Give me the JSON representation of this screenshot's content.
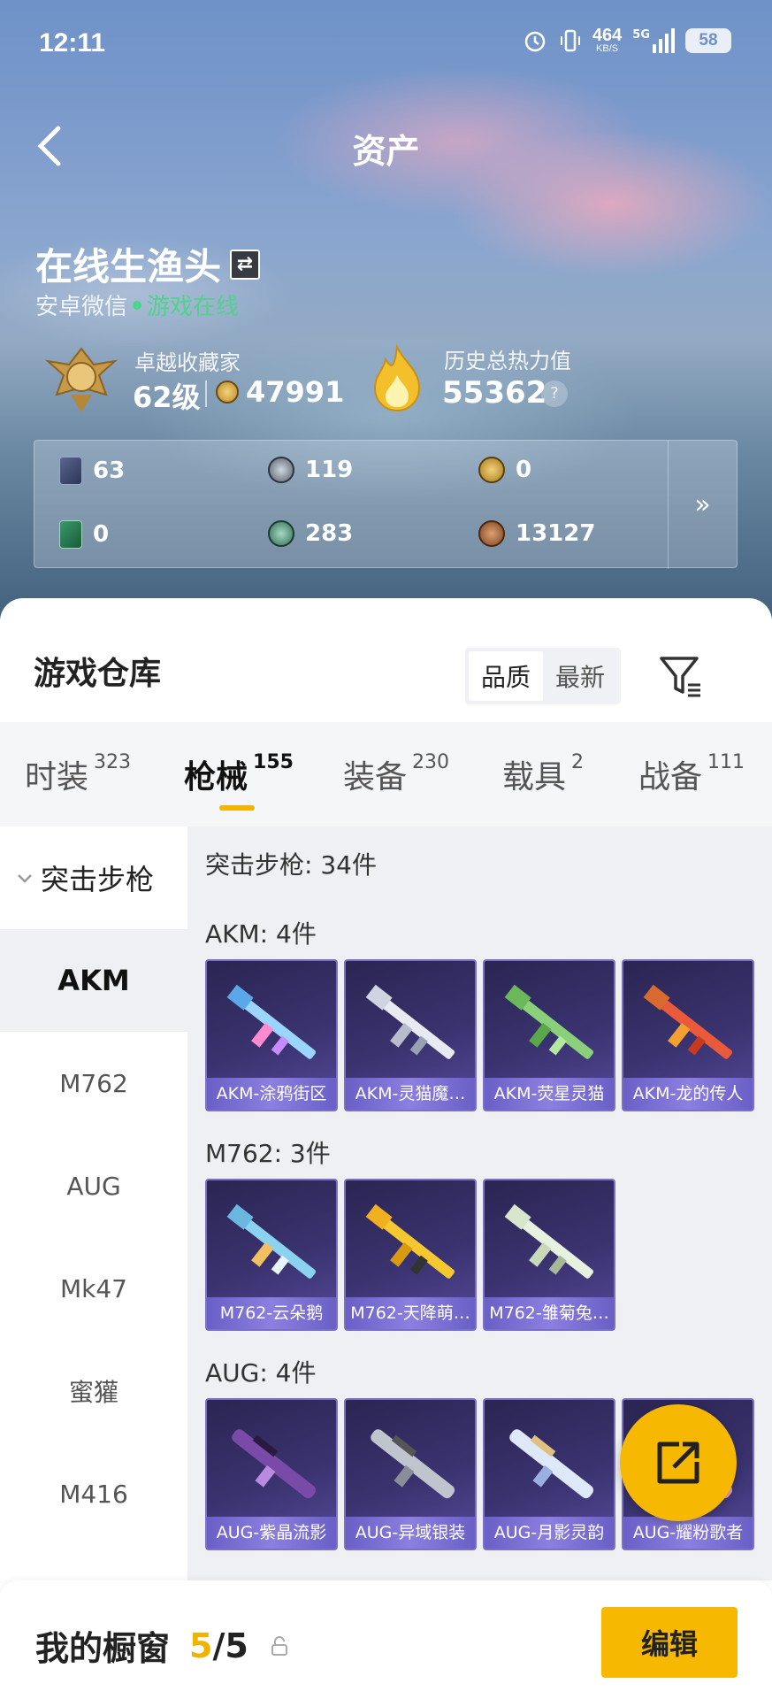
{
  "status_bar": {
    "time": "12:11",
    "net_speed": "464",
    "net_unit": "KB/S",
    "signal": "5G",
    "battery": "58"
  },
  "header": {
    "title": "资产"
  },
  "profile": {
    "username": "在线生渔头",
    "platform": "安卓微信",
    "status": "游戏在线",
    "collector_label": "卓越收藏家",
    "collector_level": "62级",
    "collector_points": "47991",
    "heat_label": "历史总热力值",
    "heat_value": "55362",
    "help_icon": "question-icon"
  },
  "stats": [
    {
      "icon": "card-icon",
      "value": "63"
    },
    {
      "icon": "silver-coin-icon",
      "value": "119"
    },
    {
      "icon": "gold-coin-icon",
      "value": "0"
    },
    {
      "icon": "green-card-icon",
      "value": "0"
    },
    {
      "icon": "token-icon",
      "value": "283"
    },
    {
      "icon": "bronze-coin-icon",
      "value": "13127"
    }
  ],
  "warehouse": {
    "title": "游戏仓库",
    "sort_options": [
      "品质",
      "最新"
    ],
    "selected_sort": "品质",
    "tabs": [
      {
        "label": "时装",
        "count": "323"
      },
      {
        "label": "枪械",
        "count": "155"
      },
      {
        "label": "装备",
        "count": "230"
      },
      {
        "label": "载具",
        "count": "2"
      },
      {
        "label": "战备",
        "count": "111"
      }
    ],
    "active_tab": "枪械",
    "sidebar": {
      "group": "突击步枪",
      "items": [
        "AKM",
        "M762",
        "AUG",
        "Mk47",
        "蜜獾",
        "M416"
      ],
      "active": "AKM"
    },
    "category_summary": "突击步枪: 34件",
    "sections": [
      {
        "title": "AKM: 4件",
        "items": [
          "AKM-涂鸦街区",
          "AKM-灵猫魔…",
          "AKM-荧星灵猫",
          "AKM-龙的传人"
        ]
      },
      {
        "title": "M762: 3件",
        "items": [
          "M762-云朵鹅",
          "M762-天降萌…",
          "M762-雏菊兔…"
        ]
      },
      {
        "title": "AUG: 4件",
        "items": [
          "AUG-紫晶流影",
          "AUG-异域银装",
          "AUG-月影灵韵",
          "AUG-耀粉歌者"
        ]
      }
    ]
  },
  "showcase": {
    "label": "我的橱窗",
    "current": "5",
    "total": "/5",
    "edit_label": "编辑"
  },
  "colors": {
    "accent": "#f6b800",
    "online": "#4fd28a",
    "card_bg": "#3a3370"
  }
}
